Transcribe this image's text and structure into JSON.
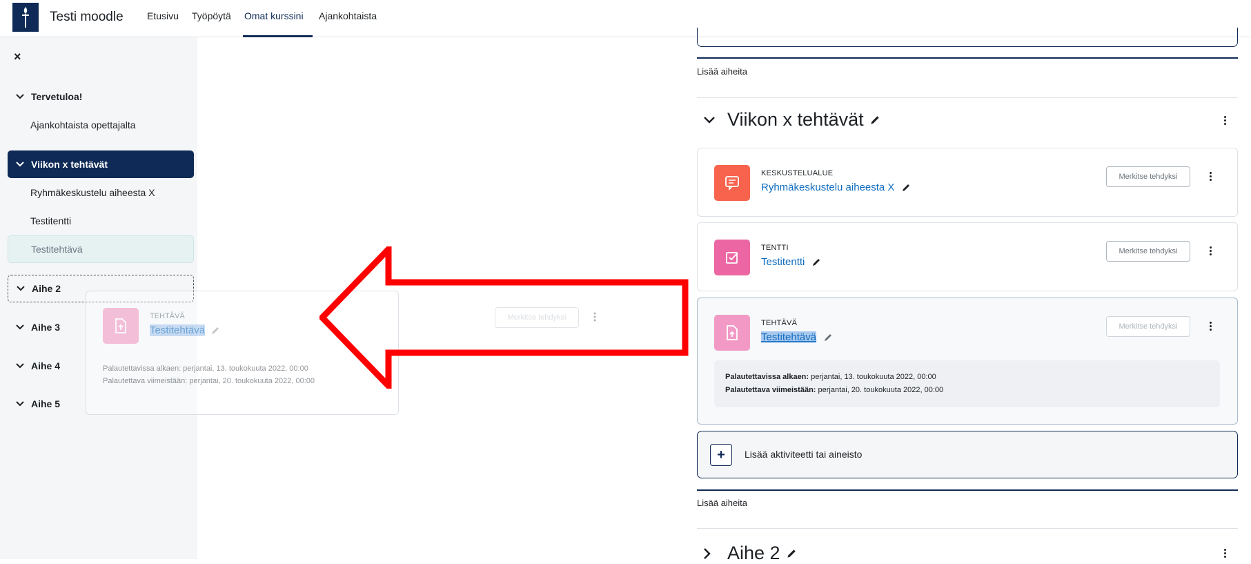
{
  "navbar": {
    "site_name": "Testi moodle",
    "links": [
      {
        "label": "Etusivu"
      },
      {
        "label": "Työpöytä"
      },
      {
        "label": "Omat kurssini",
        "active": true
      },
      {
        "label": "Ajankohtaista"
      }
    ]
  },
  "course_index": {
    "close_symbol": "×",
    "sections": {
      "welcome": {
        "label": "Tervetuloa!",
        "items": [
          "Ajankohtaista opettajalta"
        ]
      },
      "week": {
        "label": "Viikon x tehtävät",
        "items": [
          "Ryhmäkeskustelu aiheesta X",
          "Testitentti",
          "Testitehtävä"
        ]
      },
      "topic2": {
        "label": "Aihe 2"
      },
      "topic3": {
        "label": "Aihe 3"
      },
      "topic4": {
        "label": "Aihe 4"
      },
      "topic5": {
        "label": "Aihe 5"
      }
    }
  },
  "drag_ghost": {
    "type": "TEHTÄVÄ",
    "name": "Testitehtävä",
    "date_open": "Palautettavissa alkaen: perjantai, 13. toukokuuta 2022, 00:00",
    "date_due": "Palautettava viimeistään: perjantai, 20. toukokuuta 2022, 00:00",
    "button": "Merkitse tehdyksi"
  },
  "main": {
    "add_topics_1": "Lisää aiheita",
    "section_title": "Viikon x tehtävät",
    "activities": [
      {
        "type": "KESKUSTELUALUE",
        "name": "Ryhmäkeskustelu aiheesta X",
        "button": "Merkitse tehdyksi",
        "icon": "forum-icon",
        "color": "#f7634d"
      },
      {
        "type": "TENTTI",
        "name": "Testitentti",
        "button": "Merkitse tehdyksi",
        "icon": "quiz-icon",
        "color": "#eb66a2"
      },
      {
        "type": "TEHTÄVÄ",
        "name": "Testitehtävä",
        "button": "Merkitse tehdyksi",
        "icon": "assignment-icon",
        "color": "#f29ac5",
        "date_open_label": "Palautettavissa alkaen:",
        "date_open_value": " perjantai, 13. toukokuuta 2022, 00:00",
        "date_due_label": "Palautettava viimeistään:",
        "date_due_value": " perjantai, 20. toukokuuta 2022, 00:00"
      }
    ],
    "add_activity": "Lisää aktiviteetti tai aineisto",
    "add_topics_2": "Lisää aiheita",
    "next_section_title": "Aihe 2"
  },
  "colors": {
    "primary": "#0f2a56",
    "link": "#0f6cbf",
    "annotation_arrow": "#ff0000"
  }
}
